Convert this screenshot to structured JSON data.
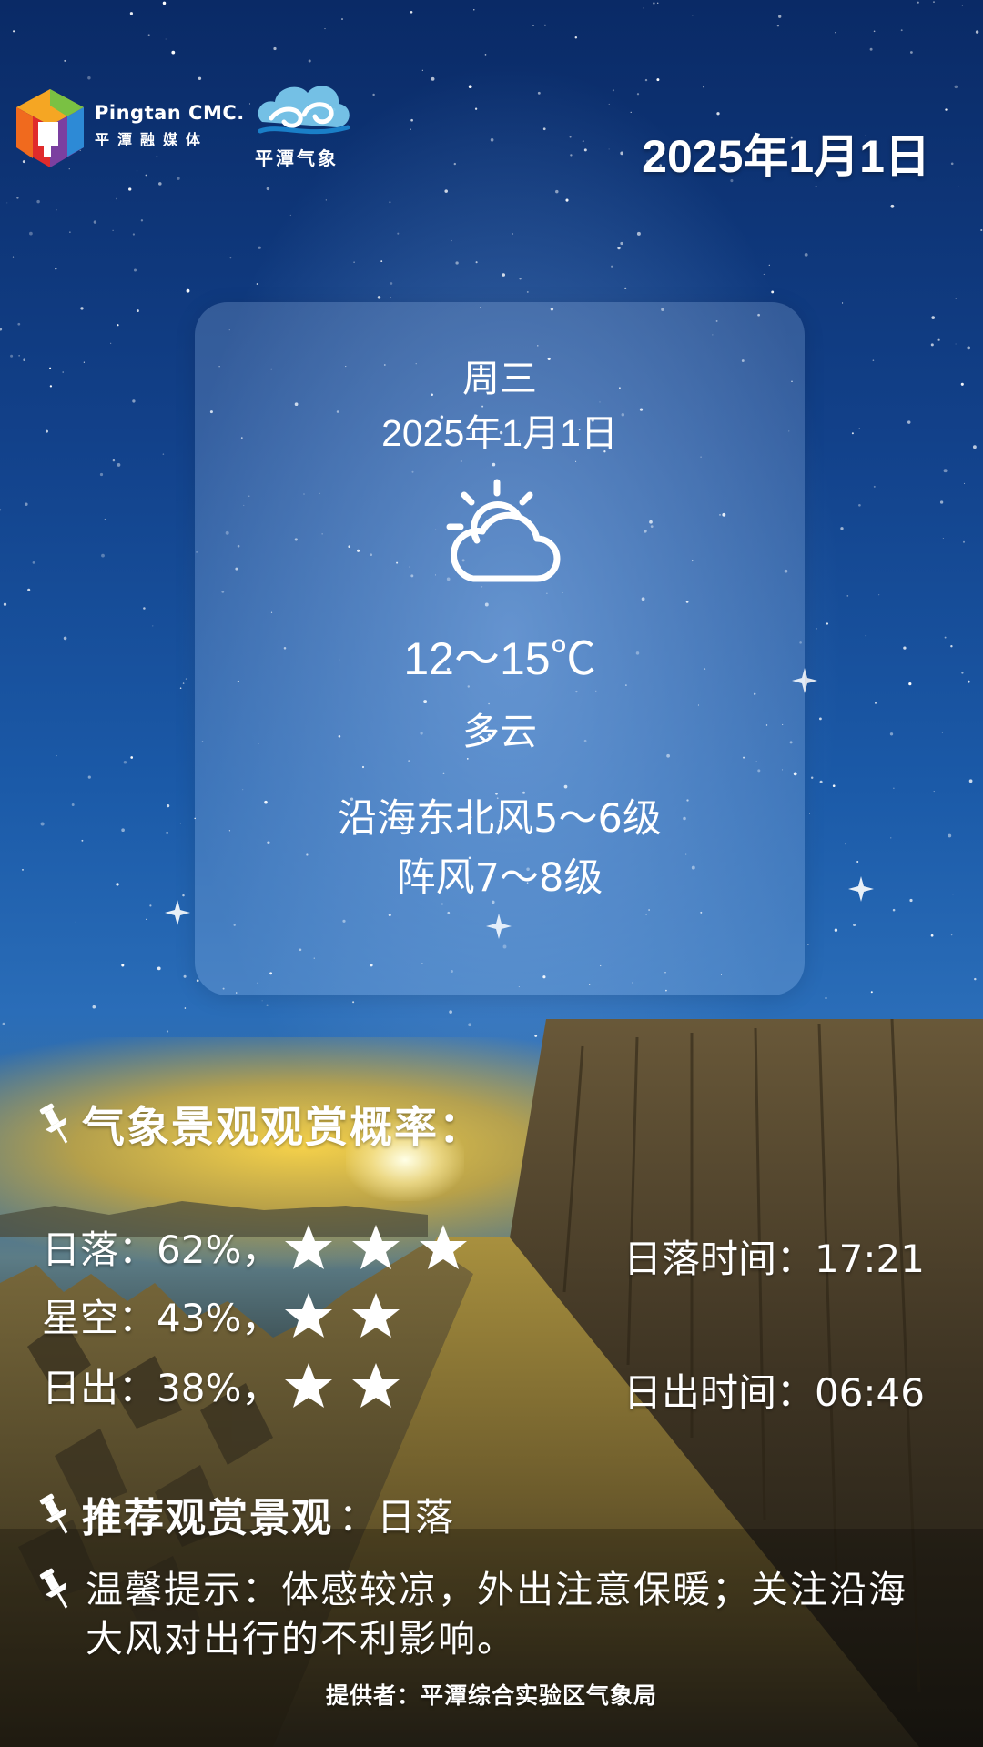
{
  "header": {
    "brand_en": "Pingtan CMC.",
    "brand_cn": "平潭融媒体",
    "weather_brand": "平潭气象",
    "date": "2025年1月1日"
  },
  "card": {
    "weekday": "周三",
    "date": "2025年1月1日",
    "icon": "partly-cloudy-icon",
    "temperature": "12～15℃",
    "condition": "多云",
    "wind_line1": "沿海东北风5～6级",
    "wind_line2": "阵风7～8级"
  },
  "scenery": {
    "heading": "气象景观观赏概率：",
    "items": [
      {
        "label": "日落：62%，",
        "stars": 3
      },
      {
        "label": "星空：43%，",
        "stars": 2
      },
      {
        "label": "日出：38%，",
        "stars": 2
      }
    ],
    "sunset_time": "日落时间：17:21",
    "sunrise_time": "日出时间：06:46"
  },
  "recommend": {
    "title": "推荐观赏景观",
    "value": "：日落"
  },
  "tip": {
    "text": "温馨提示：体感较凉，外出注意保暖；关注沿海大风对出行的不利影响。"
  },
  "footer": {
    "provider": "提供者：平潭综合实验区气象局"
  },
  "colors": {
    "sky_top": "#0a2a66",
    "sky_mid": "#1b5aa8",
    "horizon_glow": "#ffd646",
    "text": "#ffffff"
  }
}
